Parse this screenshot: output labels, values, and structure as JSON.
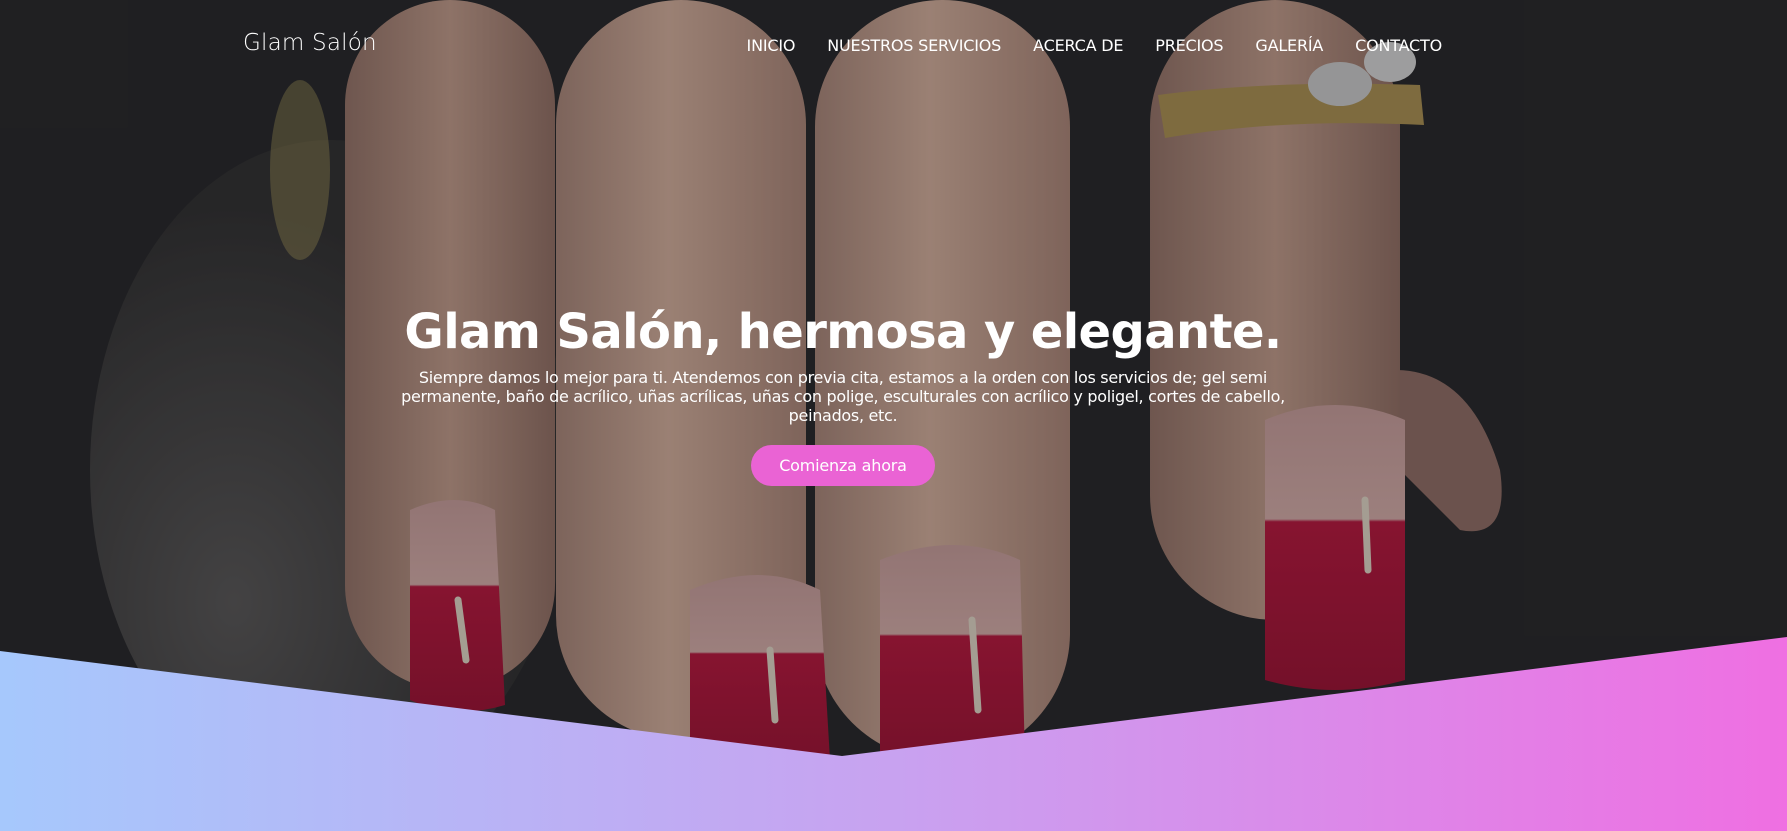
{
  "header": {
    "brand": "Glam Salón",
    "nav": [
      "INICIO",
      "NUESTROS SERVICIOS",
      "ACERCA DE",
      "PRECIOS",
      "GALERÍA",
      "CONTACTO"
    ]
  },
  "hero": {
    "title": "Glam Salón, hermosa y elegante.",
    "text": "Siempre damos lo mejor para ti. Atendemos con previa cita, estamos a la orden con los servicios de; gel semi permanente, baño de acrílico, uñas acrílicas, uñas con polige, esculturales con acrílico y poligel, cortes de cabello, peinados, etc.",
    "cta_label": "Comienza ahora",
    "background_image": "hand-with-red-manicured-nails"
  },
  "colors": {
    "accent": "#ea63d4",
    "gradient_start": "#a6c8fc",
    "gradient_mid": "#c8a2f0",
    "gradient_end": "#ef6fe2",
    "nail_red": "#c4143e",
    "background_dark": "#262628"
  }
}
